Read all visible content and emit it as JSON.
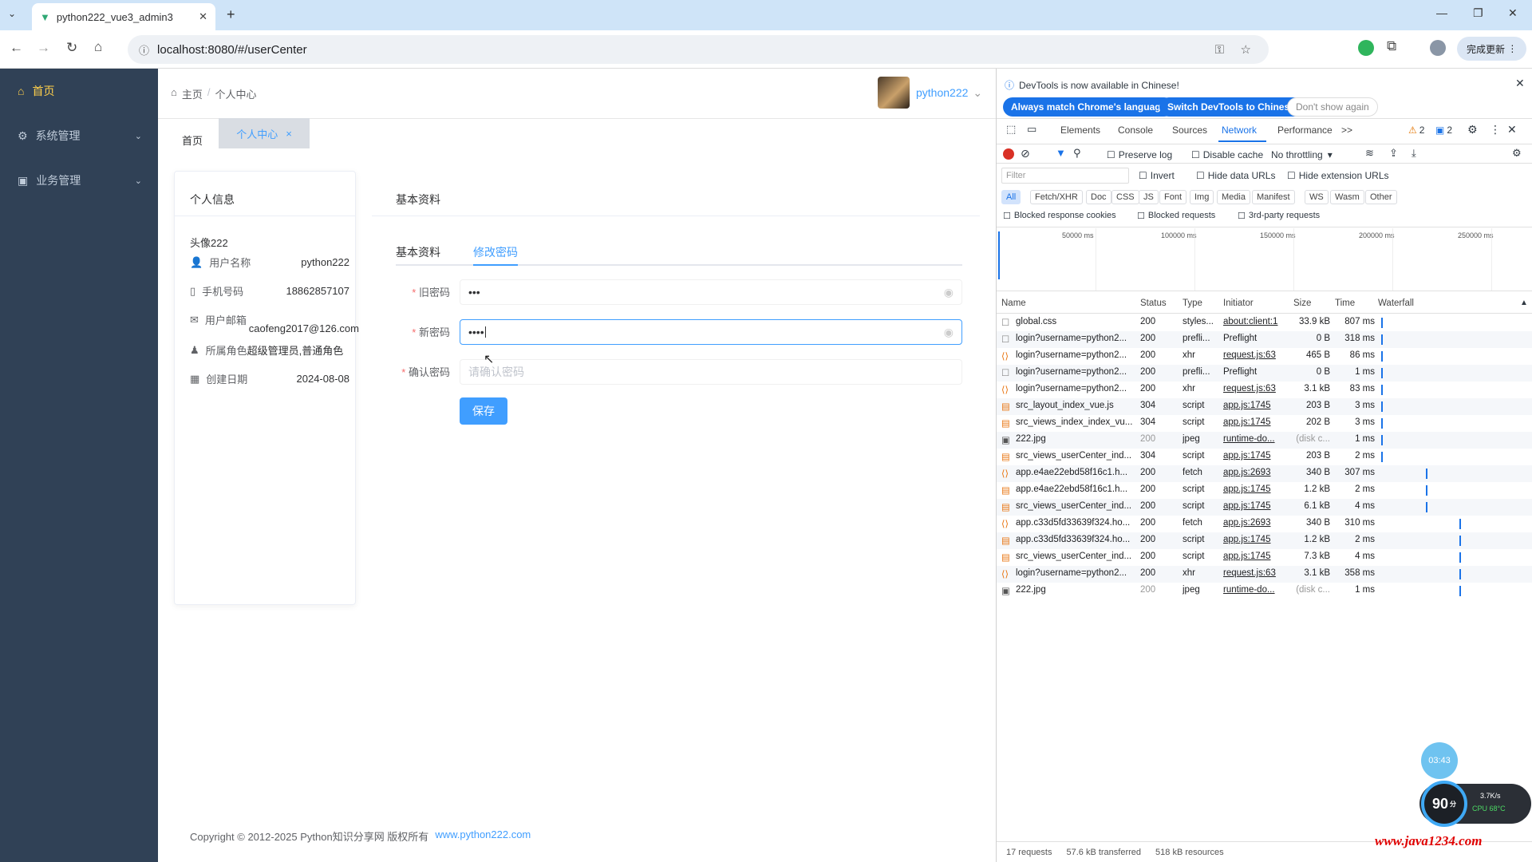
{
  "browser": {
    "tab_title": "python222_vue3_admin3",
    "url": "localhost:8080/#/userCenter",
    "update_button": "完成更新"
  },
  "sidebar": {
    "items": [
      {
        "label": "首页",
        "icon": "home-icon"
      },
      {
        "label": "系统管理",
        "icon": "gear-icon"
      },
      {
        "label": "业务管理",
        "icon": "chart-icon"
      }
    ]
  },
  "header": {
    "breadcrumb_home": "主页",
    "breadcrumb_sep": "/",
    "breadcrumb_current": "个人中心",
    "username": "python222"
  },
  "tags": {
    "home": "首页",
    "current": "个人中心",
    "close": "×"
  },
  "profile": {
    "card_title": "个人信息",
    "avatar_label": "头像222",
    "rows": [
      {
        "label": "用户名称",
        "value": "python222"
      },
      {
        "label": "手机号码",
        "value": "18862857107"
      },
      {
        "label": "用户邮箱",
        "value": "caofeng2017@126.com"
      },
      {
        "label": "所属角色",
        "value": "超级管理员,普通角色"
      },
      {
        "label": "创建日期",
        "value": "2024-08-08"
      }
    ]
  },
  "basic": {
    "card_title": "基本资料",
    "tabs": [
      "基本资料",
      "修改密码"
    ],
    "old_pwd_label": "旧密码",
    "new_pwd_label": "新密码",
    "confirm_pwd_label": "确认密码",
    "old_pwd_value": "•••",
    "new_pwd_value": "••••",
    "confirm_placeholder": "请确认密码",
    "save": "保存",
    "required_mark": "*"
  },
  "footer": {
    "text": "Copyright © 2012-2025 Python知识分享网 版权所有",
    "link": "www.python222.com"
  },
  "devtools": {
    "notice": "DevTools is now available in Chinese!",
    "btn_match": "Always match Chrome's language",
    "btn_switch": "Switch DevTools to Chinese",
    "btn_dont": "Don't show again",
    "tabs": [
      "Elements",
      "Console",
      "Sources",
      "Network",
      "Performance"
    ],
    "more": ">>",
    "warn_count": "2",
    "msg_count": "2",
    "preserve_log": "Preserve log",
    "disable_cache": "Disable cache",
    "throttling": "No throttling",
    "filter_placeholder": "Filter",
    "invert": "Invert",
    "hide_data": "Hide data URLs",
    "hide_ext": "Hide extension URLs",
    "chips": [
      "All",
      "Fetch/XHR",
      "Doc",
      "CSS",
      "JS",
      "Font",
      "Img",
      "Media",
      "Manifest",
      "WS",
      "Wasm",
      "Other"
    ],
    "blocked_cookies": "Blocked response cookies",
    "blocked_requests": "Blocked requests",
    "third_party": "3rd-party requests",
    "timeline": [
      "50000 ms",
      "100000 ms",
      "150000 ms",
      "200000 ms",
      "250000 ms"
    ],
    "columns": [
      "Name",
      "Status",
      "Type",
      "Initiator",
      "Size",
      "Time",
      "Waterfall"
    ],
    "rows": [
      {
        "name": "global.css",
        "status": "200",
        "type": "styles...",
        "initiator": "about:client:1",
        "size": "33.9 kB",
        "time": "807 ms"
      },
      {
        "name": "login?username=python2...",
        "status": "200",
        "type": "prefli...",
        "initiator": "Preflight",
        "size": "0 B",
        "time": "318 ms"
      },
      {
        "name": "login?username=python2...",
        "status": "200",
        "type": "xhr",
        "initiator": "request.js:63",
        "size": "465 B",
        "time": "86 ms"
      },
      {
        "name": "login?username=python2...",
        "status": "200",
        "type": "prefli...",
        "initiator": "Preflight",
        "size": "0 B",
        "time": "1 ms"
      },
      {
        "name": "login?username=python2...",
        "status": "200",
        "type": "xhr",
        "initiator": "request.js:63",
        "size": "3.1 kB",
        "time": "83 ms"
      },
      {
        "name": "src_layout_index_vue.js",
        "status": "304",
        "type": "script",
        "initiator": "app.js:1745",
        "size": "203 B",
        "time": "3 ms"
      },
      {
        "name": "src_views_index_index_vu...",
        "status": "304",
        "type": "script",
        "initiator": "app.js:1745",
        "size": "202 B",
        "time": "3 ms"
      },
      {
        "name": "222.jpg",
        "status": "200",
        "type": "jpeg",
        "initiator": "runtime-do...",
        "size": "(disk c...",
        "time": "1 ms"
      },
      {
        "name": "src_views_userCenter_ind...",
        "status": "304",
        "type": "script",
        "initiator": "app.js:1745",
        "size": "203 B",
        "time": "2 ms"
      },
      {
        "name": "app.e4ae22ebd58f16c1.h...",
        "status": "200",
        "type": "fetch",
        "initiator": "app.js:2693",
        "size": "340 B",
        "time": "307 ms"
      },
      {
        "name": "app.e4ae22ebd58f16c1.h...",
        "status": "200",
        "type": "script",
        "initiator": "app.js:1745",
        "size": "1.2 kB",
        "time": "2 ms"
      },
      {
        "name": "src_views_userCenter_ind...",
        "status": "200",
        "type": "script",
        "initiator": "app.js:1745",
        "size": "6.1 kB",
        "time": "4 ms"
      },
      {
        "name": "app.c33d5fd33639f324.ho...",
        "status": "200",
        "type": "fetch",
        "initiator": "app.js:2693",
        "size": "340 B",
        "time": "310 ms"
      },
      {
        "name": "app.c33d5fd33639f324.ho...",
        "status": "200",
        "type": "script",
        "initiator": "app.js:1745",
        "size": "1.2 kB",
        "time": "2 ms"
      },
      {
        "name": "src_views_userCenter_ind...",
        "status": "200",
        "type": "script",
        "initiator": "app.js:1745",
        "size": "7.3 kB",
        "time": "4 ms"
      },
      {
        "name": "login?username=python2...",
        "status": "200",
        "type": "xhr",
        "initiator": "request.js:63",
        "size": "3.1 kB",
        "time": "358 ms"
      },
      {
        "name": "222.jpg",
        "status": "200",
        "type": "jpeg",
        "initiator": "runtime-do...",
        "size": "(disk c...",
        "time": "1 ms"
      }
    ],
    "summary_requests": "17 requests",
    "summary_transferred": "57.6 kB transferred",
    "summary_resources": "518 kB resources"
  },
  "overlay": {
    "clock": "03:43",
    "speed": "90",
    "speed_unit": "分",
    "net": "3.7K/s",
    "cpu": "CPU 68°C",
    "watermark": "www.java1234.com"
  },
  "colors": {
    "sidebar": "#304156",
    "accent": "#409eff",
    "chrome": "#1a73e8",
    "watermark": "#e00000"
  }
}
